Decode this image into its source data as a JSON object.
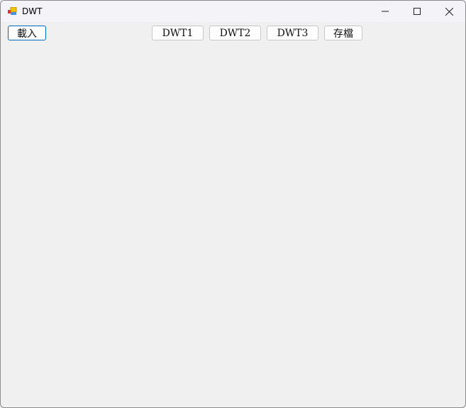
{
  "window": {
    "title": "DWT"
  },
  "toolbar": {
    "load": "載入",
    "dwt1": "DWT1",
    "dwt2": "DWT2",
    "dwt3": "DWT3",
    "save": "存檔"
  },
  "controls": {
    "minimize": "—",
    "maximize": "☐",
    "close": "✕"
  }
}
